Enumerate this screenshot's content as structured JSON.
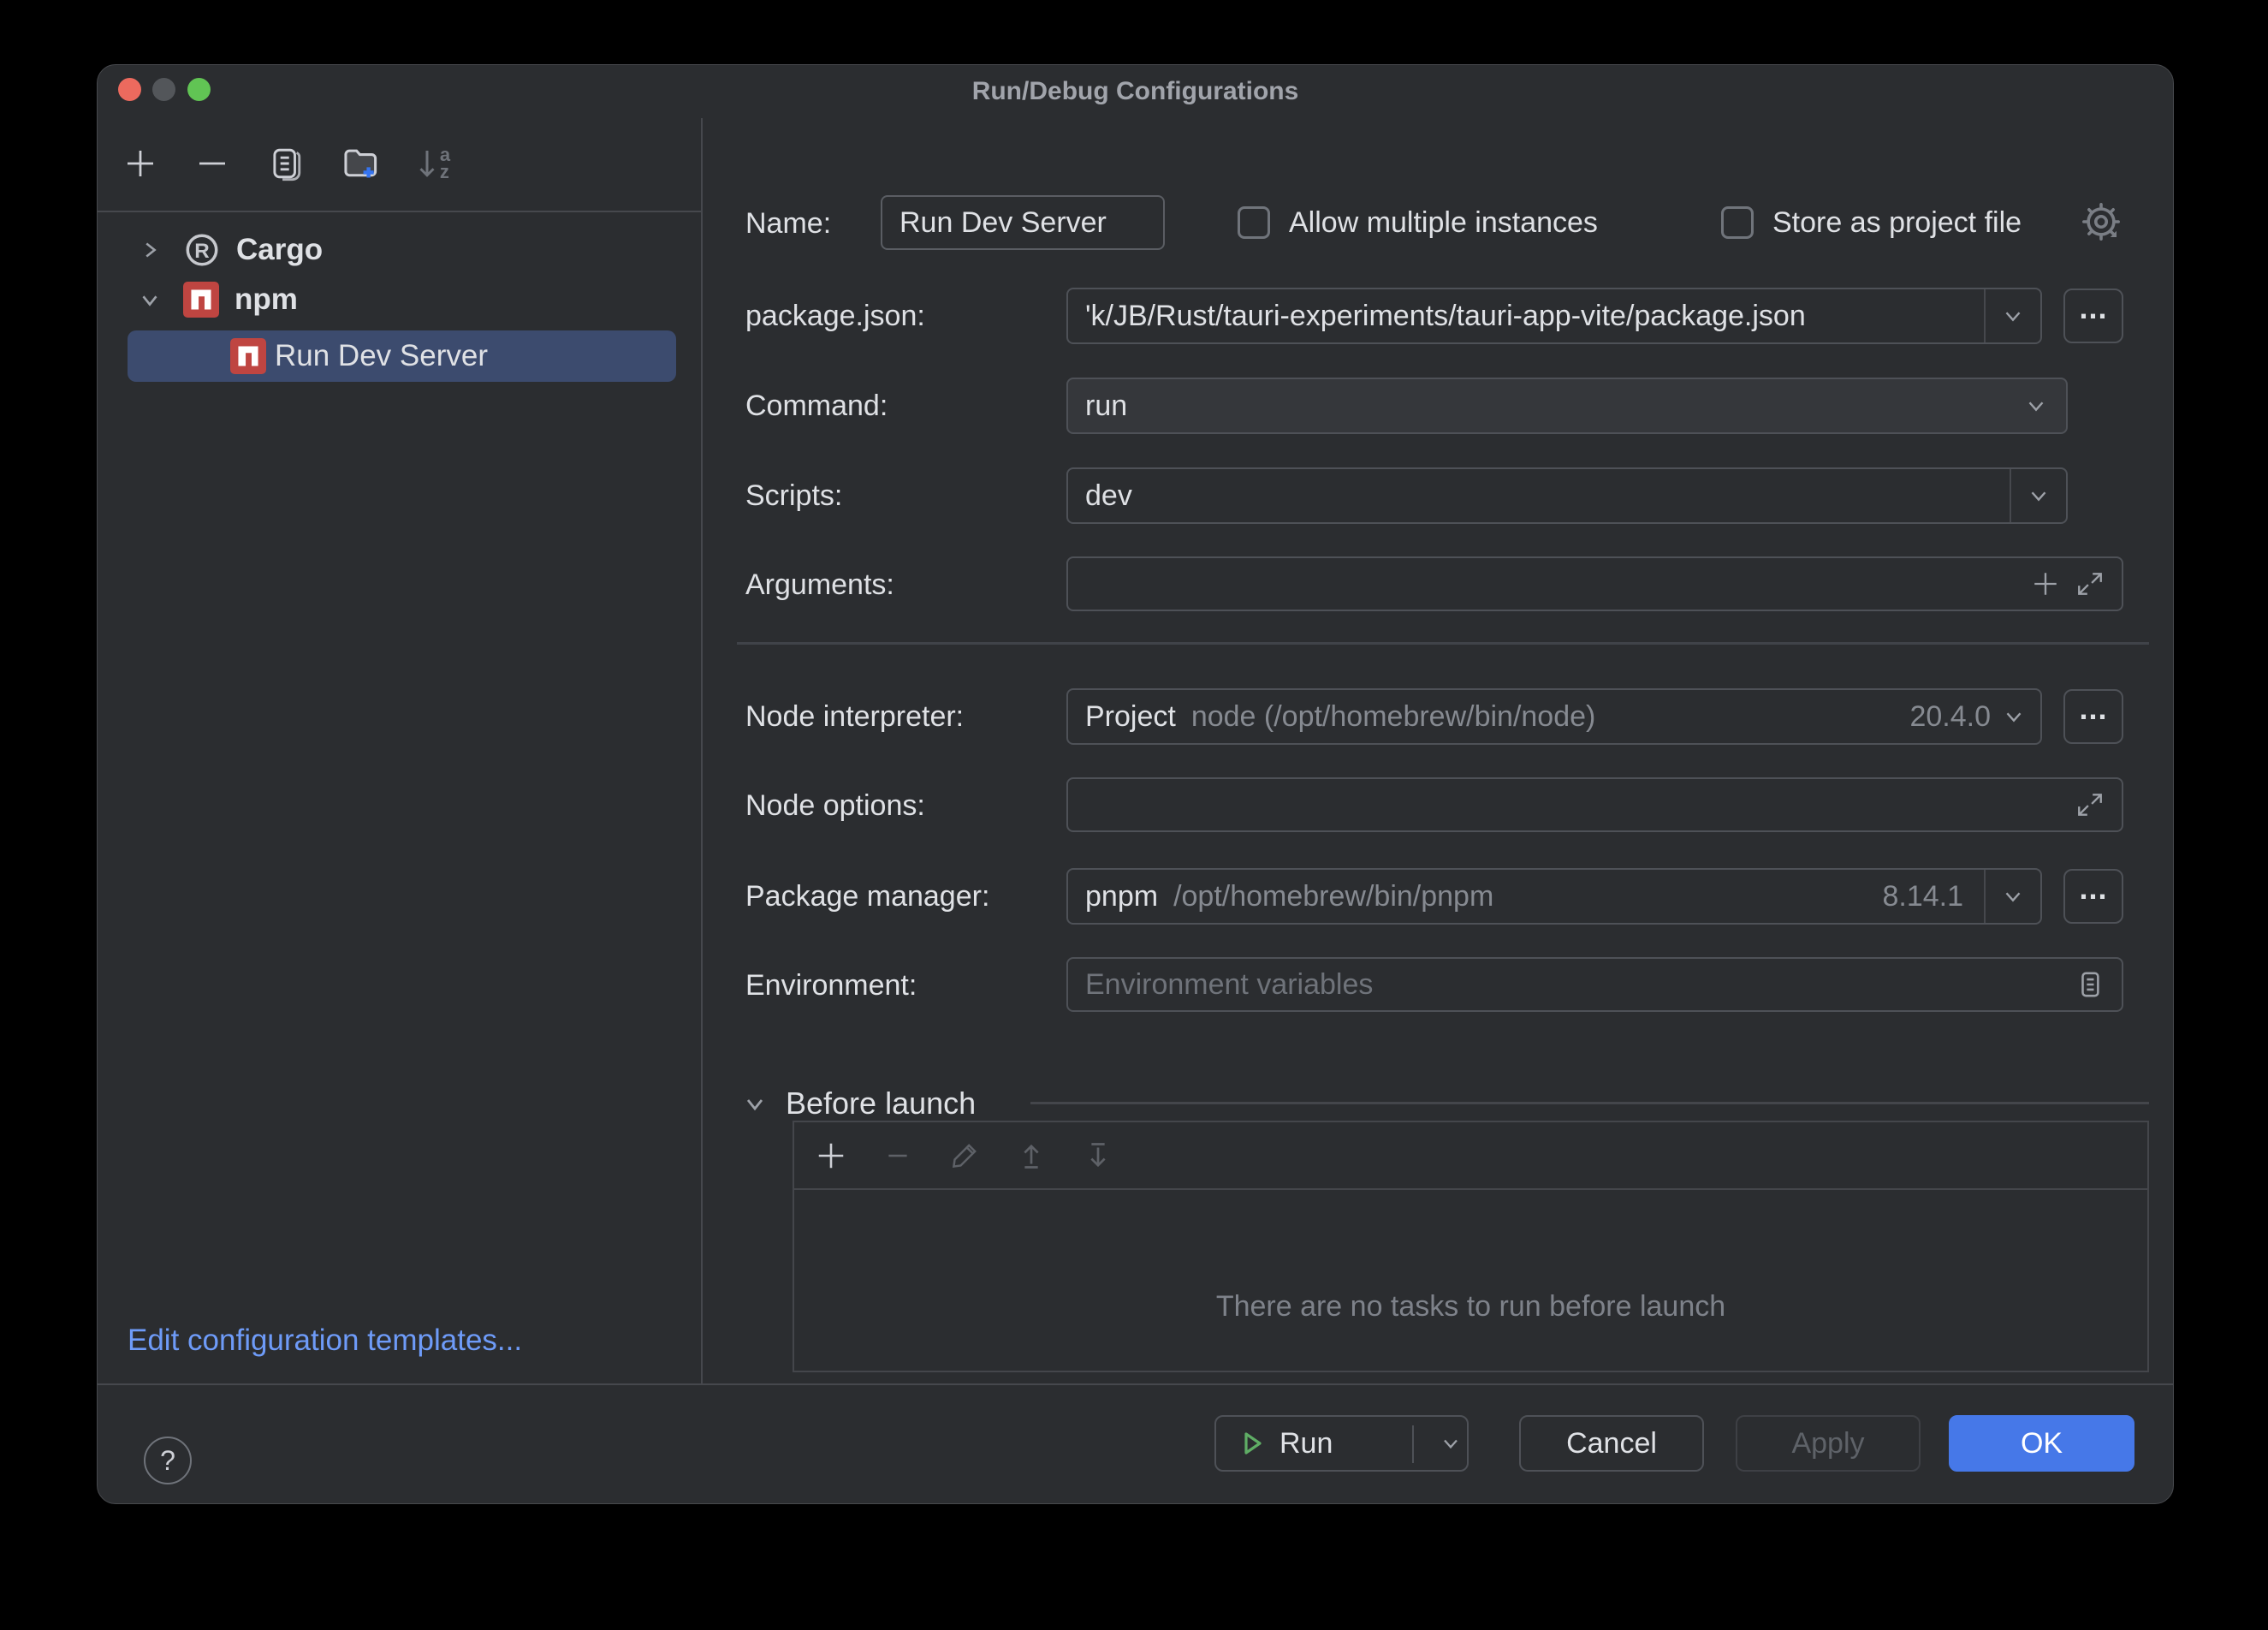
{
  "window": {
    "title": "Run/Debug Configurations"
  },
  "left_toolbar": {
    "sort_a": "a",
    "sort_z": "z"
  },
  "tree": {
    "cargo_label": "Cargo",
    "npm_label": "npm",
    "selected_label": "Run Dev Server"
  },
  "sidebar": {
    "edit_templates": "Edit configuration templates..."
  },
  "form": {
    "name_label": "Name:",
    "name_value": "Run Dev Server",
    "allow_multiple_label": "Allow multiple instances",
    "store_project_label": "Store as project file",
    "package_json_label": "package.json:",
    "package_json_value": "'k/JB/Rust/tauri-experiments/tauri-app-vite/package.json",
    "command_label": "Command:",
    "command_value": "run",
    "scripts_label": "Scripts:",
    "scripts_value": "dev",
    "arguments_label": "Arguments:",
    "arguments_value": "",
    "node_interpreter_label": "Node interpreter:",
    "node_interpreter_value": "Project",
    "node_interpreter_detail": "node (/opt/homebrew/bin/node)",
    "node_interpreter_version": "20.4.0",
    "node_options_label": "Node options:",
    "node_options_value": "",
    "package_manager_label": "Package manager:",
    "package_manager_value": "pnpm",
    "package_manager_detail": "/opt/homebrew/bin/pnpm",
    "package_manager_version": "8.14.1",
    "environment_label": "Environment:",
    "environment_placeholder": "Environment variables",
    "ellipsis": "..."
  },
  "before_launch": {
    "title": "Before launch",
    "empty_text": "There are no tasks to run before launch"
  },
  "footer": {
    "help": "?",
    "run": "Run",
    "cancel": "Cancel",
    "apply": "Apply",
    "ok": "OK"
  },
  "colors": {
    "dialog_bg": "#2B2D30",
    "selection_blue": "#3C4B6E",
    "accent_blue": "#4678E8",
    "link_blue": "#6E9BF8",
    "npm_red": "#BF4541",
    "run_green": "#5FAD65"
  }
}
